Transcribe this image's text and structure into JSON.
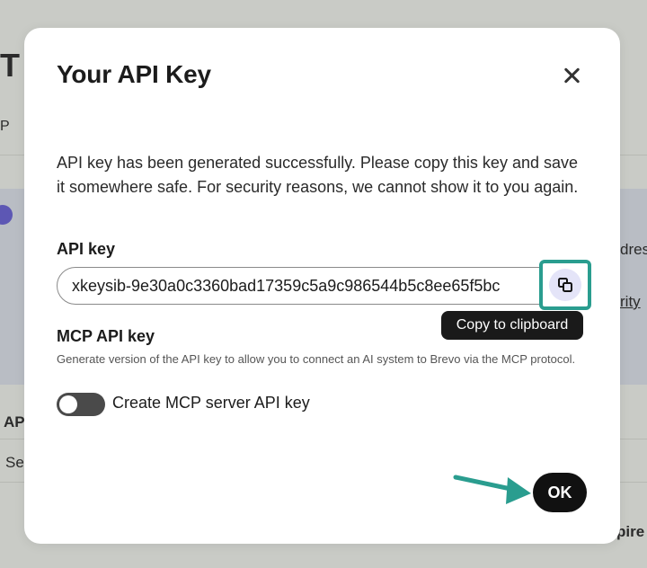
{
  "background": {
    "title_fragment": "T",
    "p_fragment": "P",
    "ap_fragment": "AP",
    "se_fragment": "Se",
    "dres_fragment": "dres",
    "rity_fragment": "rity",
    "pire_fragment": "pire"
  },
  "modal": {
    "title": "Your API Key",
    "description": "API key has been generated successfully. Please copy this key and save it somewhere safe. For security reasons, we cannot show it to you again.",
    "api_key_label": "API key",
    "api_key_value": "xkeysib-9e30a0c3360bad17359c5a9c986544b5c8ee65f5bc",
    "copy_tooltip": "Copy to clipboard",
    "mcp_label": "MCP API key",
    "mcp_help": "Generate version of the API key to allow you to connect an AI system to Brevo via the MCP protocol.",
    "toggle_label": "Create MCP server API key",
    "toggle_on": false,
    "ok_label": "OK"
  },
  "colors": {
    "highlight": "#2a9d8f",
    "overlay": "#c9cbc6",
    "primary_button": "#111111",
    "copy_button_bg": "#e4e4f8"
  },
  "icons": {
    "close": "close-icon",
    "copy": "copy-icon",
    "annotation": "arrow-right-icon"
  }
}
